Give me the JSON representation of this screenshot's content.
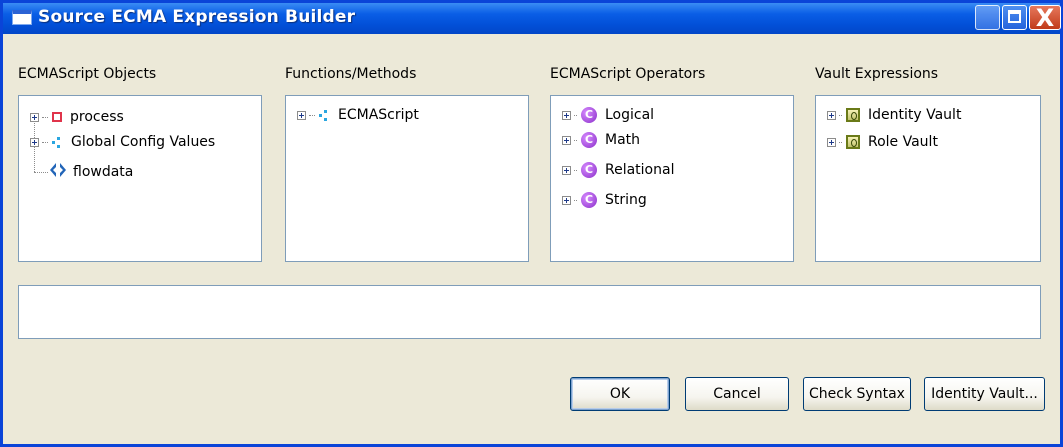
{
  "window": {
    "title": "Source ECMA Expression Builder"
  },
  "panels": {
    "objects": {
      "label": "ECMAScript Objects",
      "items": [
        {
          "label": "process",
          "icon": "red-square-icon",
          "expandable": true
        },
        {
          "label": "Global Config Values",
          "icon": "blue-dots-icon",
          "expandable": true
        },
        {
          "label": "flowdata",
          "icon": "flow-arrows-icon",
          "expandable": false
        }
      ]
    },
    "functions": {
      "label": "Functions/Methods",
      "items": [
        {
          "label": "ECMAScript",
          "icon": "blue-dots-icon",
          "expandable": true
        }
      ]
    },
    "operators": {
      "label": "ECMAScript Operators",
      "items": [
        {
          "label": "Logical",
          "icon": "class-c-icon",
          "expandable": true
        },
        {
          "label": "Math",
          "icon": "class-c-icon",
          "expandable": true
        },
        {
          "label": "Relational",
          "icon": "class-c-icon",
          "expandable": true
        },
        {
          "label": "String",
          "icon": "class-c-icon",
          "expandable": true
        }
      ]
    },
    "vault": {
      "label": "Vault Expressions",
      "items": [
        {
          "label": "Identity Vault",
          "icon": "vault-icon",
          "expandable": true
        },
        {
          "label": "Role Vault",
          "icon": "vault-icon",
          "expandable": true
        }
      ]
    }
  },
  "expression": {
    "value": ""
  },
  "buttons": {
    "ok": "OK",
    "cancel": "Cancel",
    "check_syntax": "Check Syntax",
    "identity_vault": "Identity Vault..."
  },
  "icons": {
    "class_glyph": "C",
    "close_glyph": "X"
  }
}
